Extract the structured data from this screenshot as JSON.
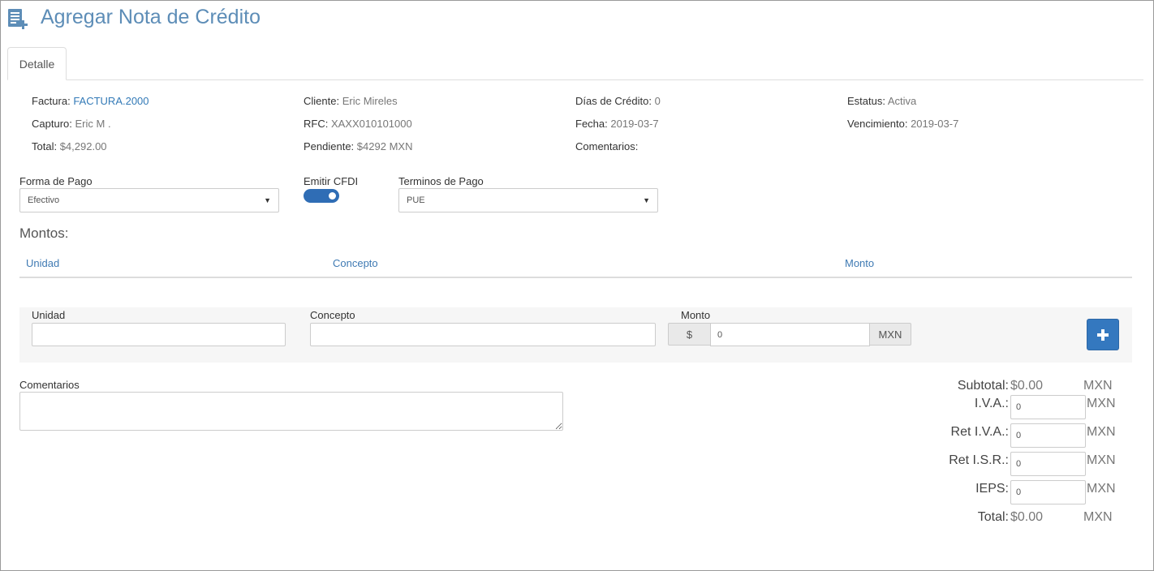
{
  "page": {
    "title": "Agregar Nota de Crédito",
    "icon": "add-document-icon",
    "accent": "#5d8db7"
  },
  "tabs": [
    {
      "label": "Detalle",
      "active": true
    }
  ],
  "info": {
    "factura": {
      "label": "Factura:",
      "value": "FACTURA.2000"
    },
    "capturo": {
      "label": "Capturo:",
      "value": "Eric M ."
    },
    "total": {
      "label": "Total:",
      "value": "$4,292.00"
    },
    "cliente": {
      "label": "Cliente:",
      "value": "Eric Mireles"
    },
    "rfc": {
      "label": "RFC:",
      "value": "XAXX010101000"
    },
    "pendiente": {
      "label": "Pendiente:",
      "value": "$4292",
      "currency": "MXN"
    },
    "dias_credito": {
      "label": "Días de Crédito:",
      "value": "0"
    },
    "fecha": {
      "label": "Fecha:",
      "value": "2019-03-7"
    },
    "comentarios": {
      "label": "Comentarios:",
      "value": ""
    },
    "estatus": {
      "label": "Estatus:",
      "value": "Activa"
    },
    "vencimiento": {
      "label": "Vencimiento:",
      "value": "2019-03-7"
    }
  },
  "form": {
    "forma_pago": {
      "label": "Forma de Pago",
      "value": "Efectivo"
    },
    "emitir_cfdi": {
      "label": "Emitir CFDI",
      "checked": true
    },
    "terminos_pago": {
      "label": "Terminos de Pago",
      "value": "PUE"
    }
  },
  "montos": {
    "title": "Montos:",
    "columns": [
      "Unidad",
      "Concepto",
      "Monto"
    ],
    "rows": []
  },
  "add_row": {
    "unidad_label": "Unidad",
    "unidad_value": "",
    "concepto_label": "Concepto",
    "concepto_value": "",
    "monto_label": "Monto",
    "currency_prefix": "$",
    "monto_value": "0",
    "currency_suffix": "MXN",
    "add_button_icon": "plus-icon"
  },
  "comentarios": {
    "label": "Comentarios",
    "value": ""
  },
  "totals": {
    "subtotal": {
      "label": "Subtotal:",
      "value": "$0.00",
      "currency": "MXN"
    },
    "iva": {
      "label": "I.V.A.:",
      "value": "0",
      "currency": "MXN"
    },
    "ret_iva": {
      "label": "Ret I.V.A.:",
      "value": "0",
      "currency": "MXN"
    },
    "ret_isr": {
      "label": "Ret I.S.R.:",
      "value": "0",
      "currency": "MXN"
    },
    "ieps": {
      "label": "IEPS:",
      "value": "0",
      "currency": "MXN"
    },
    "total": {
      "label": "Total:",
      "value": "$0.00",
      "currency": "MXN"
    }
  }
}
